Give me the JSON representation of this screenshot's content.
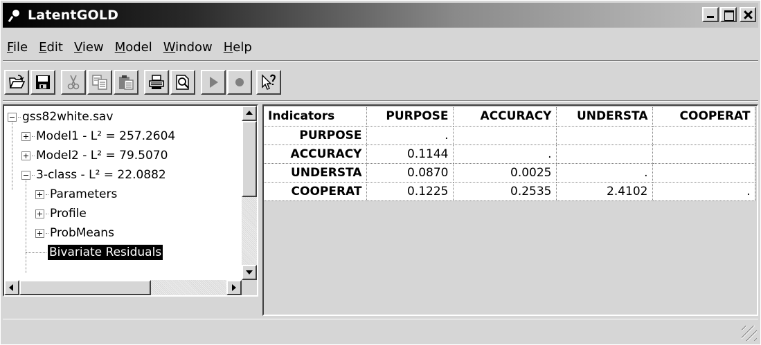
{
  "window": {
    "title": "LatentGOLD"
  },
  "menu": [
    {
      "label": "File",
      "key": "F",
      "rest": "ile"
    },
    {
      "label": "Edit",
      "key": "E",
      "rest": "dit"
    },
    {
      "label": "View",
      "key": "V",
      "rest": "iew"
    },
    {
      "label": "Model",
      "key": "M",
      "rest": "odel"
    },
    {
      "label": "Window",
      "key": "W",
      "rest": "indow"
    },
    {
      "label": "Help",
      "key": "H",
      "rest": "elp"
    }
  ],
  "toolbar": [
    {
      "name": "open-icon",
      "enabled": true
    },
    {
      "name": "save-icon",
      "enabled": true
    },
    {
      "name": "cut-icon",
      "enabled": false
    },
    {
      "name": "copy-icon",
      "enabled": false
    },
    {
      "name": "paste-icon",
      "enabled": false
    },
    {
      "name": "print-icon",
      "enabled": true
    },
    {
      "name": "print-preview-icon",
      "enabled": true
    },
    {
      "name": "run-icon",
      "enabled": false
    },
    {
      "name": "stop-icon",
      "enabled": false
    },
    {
      "name": "context-help-icon",
      "enabled": true
    }
  ],
  "tree": {
    "root": "gss82white.sav",
    "models": [
      {
        "label": "Model1 - L² = 257.2604",
        "expanded": false
      },
      {
        "label": "Model2 - L² = 79.5070",
        "expanded": false
      },
      {
        "label": "3-class - L² = 22.0882",
        "expanded": true
      }
    ],
    "children": [
      {
        "label": "Parameters",
        "expandable": true
      },
      {
        "label": "Profile",
        "expandable": true
      },
      {
        "label": "ProbMeans",
        "expandable": true
      },
      {
        "label": "Bivariate Residuals",
        "expandable": false,
        "selected": true
      }
    ]
  },
  "grid": {
    "corner": "Indicators",
    "columns": [
      "PURPOSE",
      "ACCURACY",
      "UNDERSTA",
      "COOPERAT"
    ],
    "rows": [
      {
        "label": "PURPOSE",
        "cells": [
          ".",
          "",
          "",
          ""
        ]
      },
      {
        "label": "ACCURACY",
        "cells": [
          "0.1144",
          ".",
          "",
          ""
        ]
      },
      {
        "label": "UNDERSTA",
        "cells": [
          "0.0870",
          "0.0025",
          ".",
          ""
        ]
      },
      {
        "label": "COOPERAT",
        "cells": [
          "0.1225",
          "0.2535",
          "2.4102",
          "."
        ]
      }
    ]
  },
  "colors": {
    "titlebar_start": "#000000",
    "titlebar_end": "#c6c6c6",
    "face": "#d6d6d6",
    "selection": "#000000"
  }
}
